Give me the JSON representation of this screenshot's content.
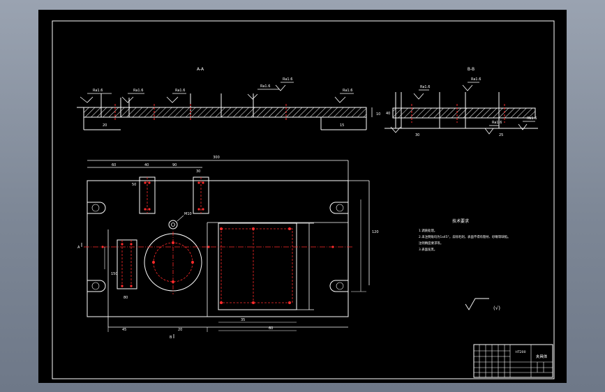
{
  "app": {
    "viewport_background": "#8a93a2",
    "sheet_background": "#000000",
    "line_color": "#ffffff",
    "center_line_color": "#ff2a2a"
  },
  "section_views": {
    "left_title": "A-A",
    "right_title": "B-B",
    "roughness_label": "Ra1.6",
    "dim_values": [
      "20",
      "15",
      "10",
      "40",
      "30",
      "25"
    ]
  },
  "plan_view": {
    "overall_width_label": "300",
    "dims": [
      "60",
      "40",
      "90",
      "30",
      "45",
      "20",
      "35",
      "60",
      "120",
      "150",
      "80",
      "50"
    ],
    "section_mark_a": "A",
    "section_mark_b": "B",
    "callout_label": "M10"
  },
  "tech_requirements": {
    "heading": "技术要求",
    "lines": [
      "1.调质处理。",
      "2.未注倒角均为1x45°，去除毛刺，表面不得有裂纹、砂眼等缺陷。",
      "注明精度要求等。",
      "3.表面发黑。"
    ]
  },
  "surface_symbol": {
    "label": "(√)"
  },
  "title_block": {
    "part_name": "夹具体",
    "material": "HT200"
  }
}
